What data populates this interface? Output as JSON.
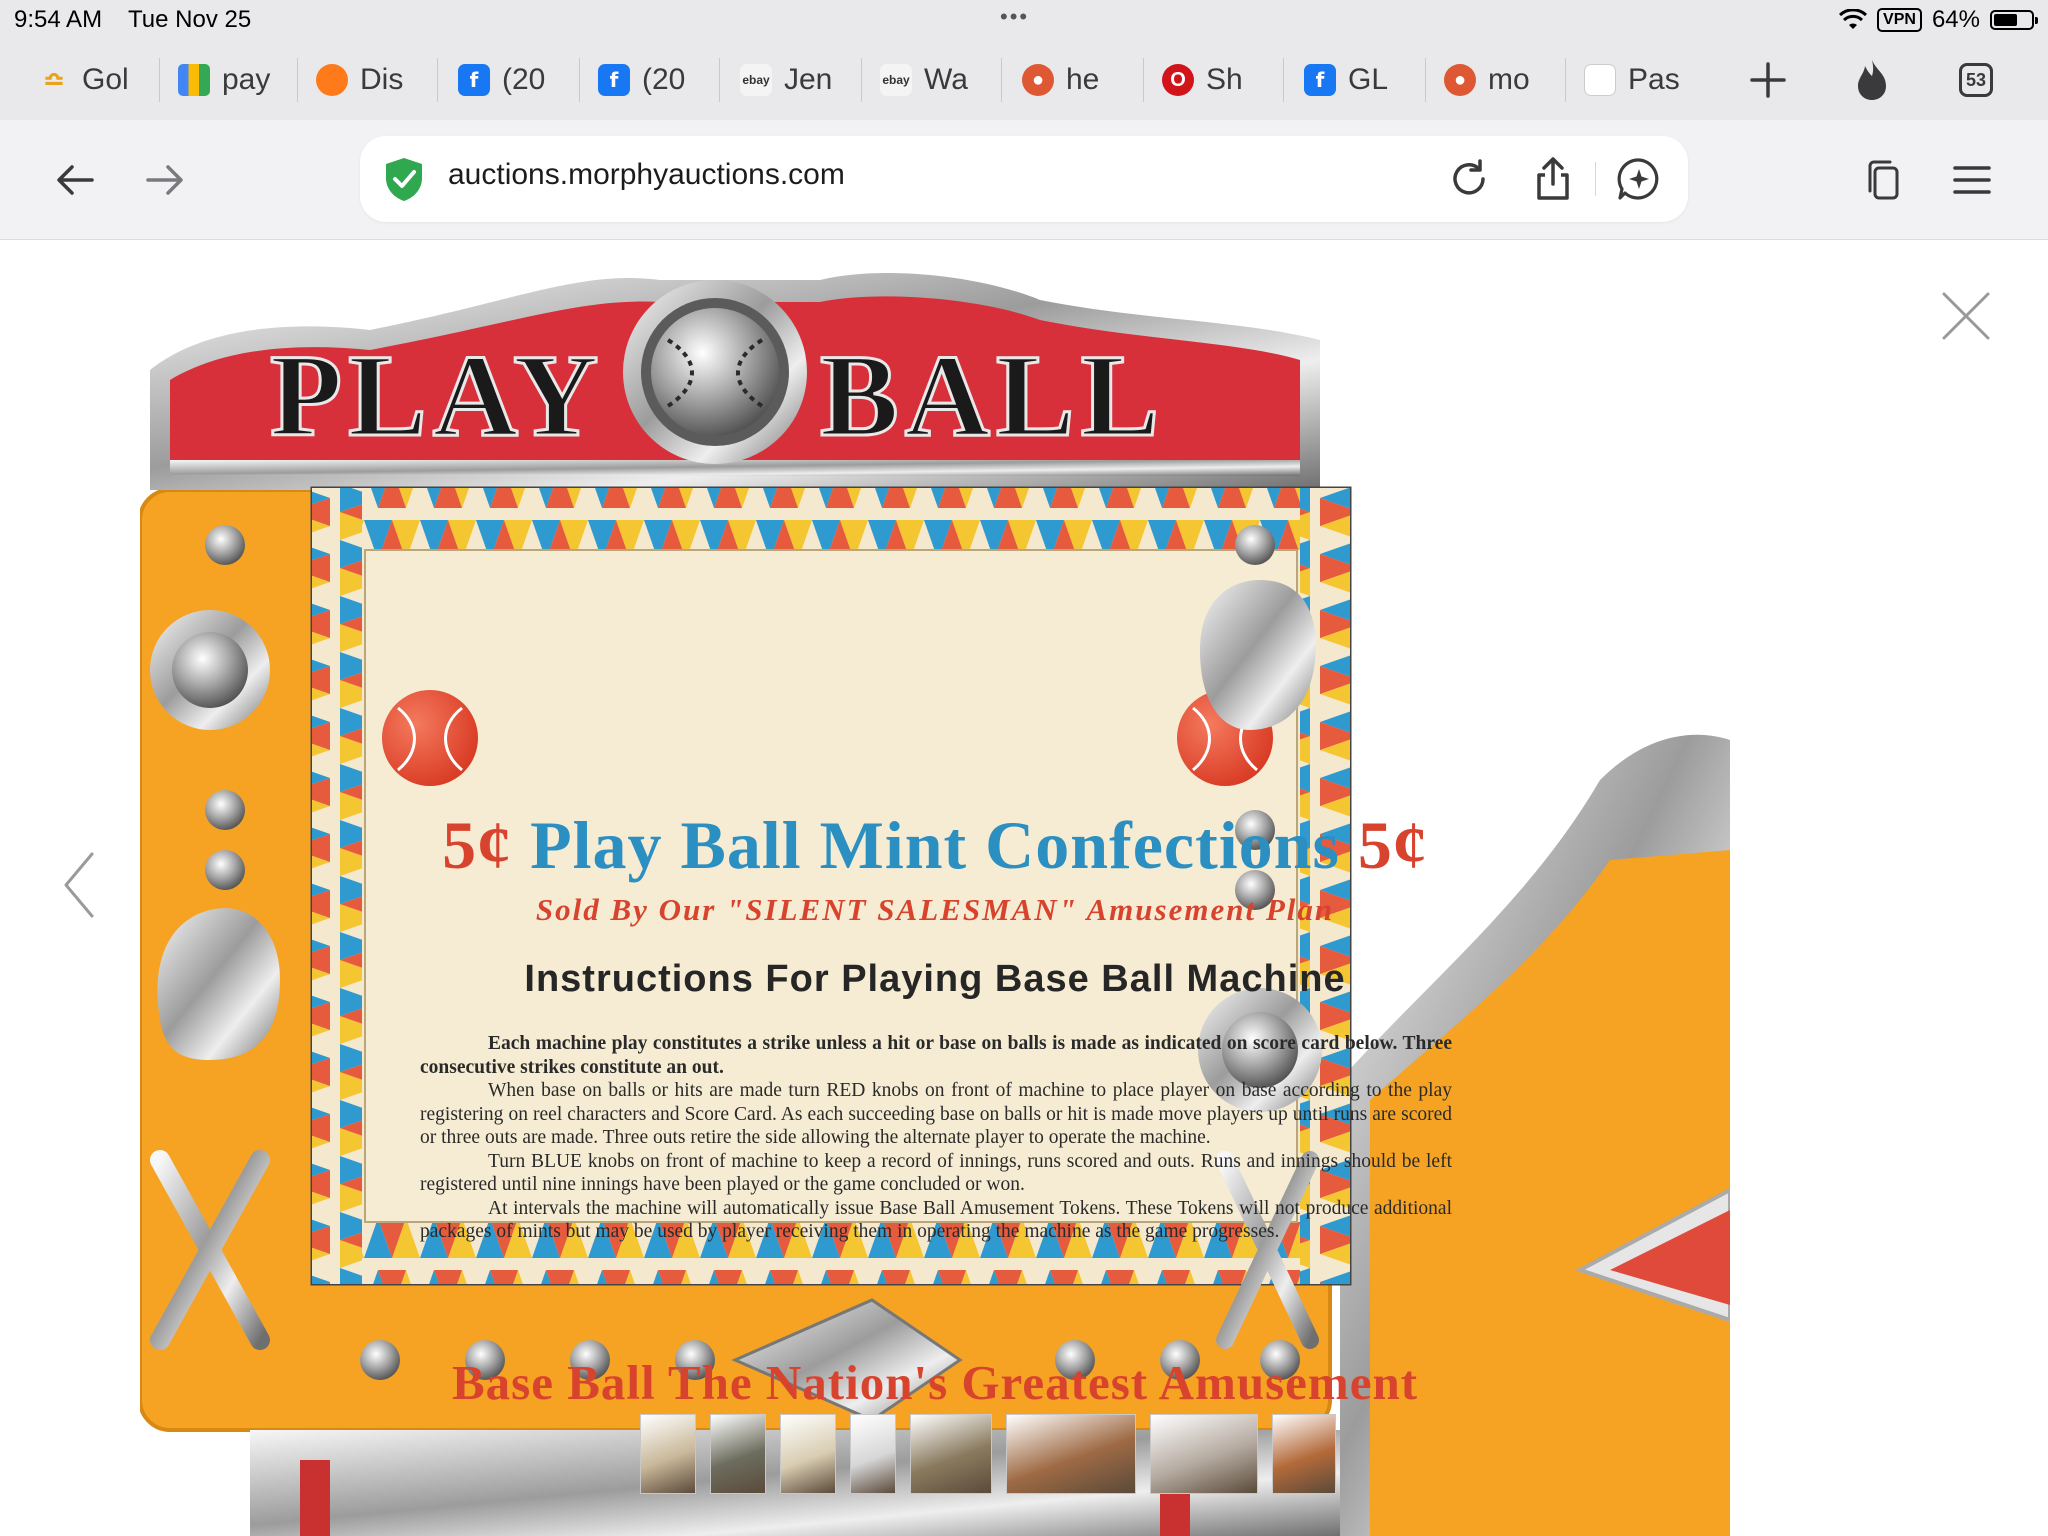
{
  "status_bar": {
    "time": "9:54 AM",
    "date": "Tue Nov 25",
    "vpn": "VPN",
    "battery": "64%",
    "battery_level": 0.64
  },
  "tabs": [
    {
      "label": "Gol",
      "icon": "gold-crown-icon"
    },
    {
      "label": "pay",
      "icon": "shopping-bag-icon"
    },
    {
      "label": "Dis",
      "icon": "orange-circle-icon"
    },
    {
      "label": "(20",
      "icon": "facebook-icon"
    },
    {
      "label": "(20",
      "icon": "facebook-icon"
    },
    {
      "label": "Jen",
      "icon": "ebay-icon"
    },
    {
      "label": "Wa",
      "icon": "ebay-icon"
    },
    {
      "label": "he",
      "icon": "duckduckgo-icon"
    },
    {
      "label": "Sh",
      "icon": "red-circle-icon"
    },
    {
      "label": "GL",
      "icon": "facebook-icon"
    },
    {
      "label": "mo",
      "icon": "duckduckgo-icon"
    },
    {
      "label": "Pas",
      "icon": "blank-page-icon"
    }
  ],
  "tab_tools": {
    "new_tab_icon": "plus-icon",
    "fire_icon": "flame-icon",
    "tab_count": "53"
  },
  "toolbar": {
    "url": "auctions.morphyauctions.com"
  },
  "card": {
    "price_left": "5¢",
    "title": "Play Ball Mint Confections",
    "price_right": "5¢",
    "subtitle": "Sold By Our \"SILENT SALESMAN\" Amusement Plan",
    "heading": "Instructions For Playing Base Ball Machine",
    "paragraphs": [
      "Each machine play constitutes a strike unless a hit or base on balls is made as indicated on score card below. Three consecutive strikes constitute an out.",
      "When base on balls or hits are made turn RED knobs on front of machine to place player on base according to the play registering on reel characters and Score Card. As each succeeding base on balls or hit is made move players up until runs are scored or three outs are made. Three outs retire the side allowing the alternate player to operate the machine.",
      "Turn BLUE knobs on front of machine to keep a record of innings, runs scored and outs. Runs and innings should be left registered until nine innings have been played or the game concluded or won.",
      "At intervals the machine will automatically issue Base Ball Amusement Tokens. These Tokens will not produce additional packages of mints but may be used by player receiving them in operating the machine as the game progresses."
    ],
    "footer": "Base Ball The Nation's Greatest Amusement"
  },
  "marquee": {
    "left_word": "PLAY",
    "right_word": "BALL"
  },
  "thumbnails": [
    {
      "name": "thumb-1",
      "color": "#c9b89a"
    },
    {
      "name": "thumb-2",
      "color": "#6d6d5f"
    },
    {
      "name": "thumb-3",
      "color": "#d9cdb2"
    },
    {
      "name": "thumb-4",
      "color": "#d7d7d7"
    },
    {
      "name": "thumb-5",
      "color": "#8a7b5f"
    },
    {
      "name": "thumb-6",
      "color": "#9e6a44"
    },
    {
      "name": "thumb-7",
      "color": "#b5aaa0"
    },
    {
      "name": "thumb-8",
      "color": "#b46a3a"
    }
  ]
}
